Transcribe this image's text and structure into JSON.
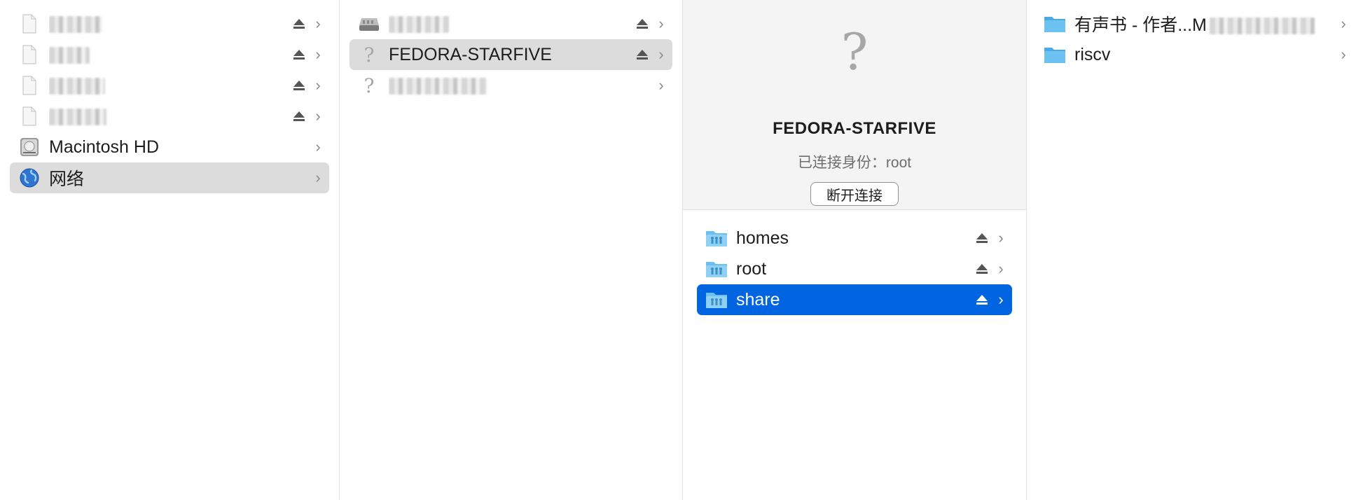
{
  "sidebar": {
    "items": [
      {
        "label": "",
        "redacted": true,
        "icon": "document-icon",
        "has_eject": true
      },
      {
        "label": "",
        "redacted": true,
        "icon": "document-icon",
        "has_eject": true
      },
      {
        "label": "",
        "redacted": true,
        "icon": "document-icon",
        "has_eject": true
      },
      {
        "label": "",
        "redacted": true,
        "icon": "document-icon",
        "has_eject": true
      },
      {
        "label": "Macintosh HD",
        "icon": "hard-drive-icon",
        "has_eject": false
      },
      {
        "label": "网络",
        "icon": "globe-icon",
        "has_eject": false,
        "selected": true
      }
    ]
  },
  "network": {
    "items": [
      {
        "label": "",
        "redacted": true,
        "icon": "server-icon",
        "has_eject": true
      },
      {
        "label": "FEDORA-STARFIVE",
        "icon": "question-icon",
        "has_eject": true,
        "selected": true
      },
      {
        "label": "",
        "redacted": true,
        "icon": "question-icon",
        "has_eject": false
      }
    ]
  },
  "server_preview": {
    "icon": "question-icon",
    "title": "FEDORA-STARFIVE",
    "connected_as": "已连接身份：root",
    "disconnect_label": "断开连接"
  },
  "shares": {
    "items": [
      {
        "label": "homes",
        "icon": "shared-folder-icon",
        "has_eject": true
      },
      {
        "label": "root",
        "icon": "shared-folder-icon",
        "has_eject": true
      },
      {
        "label": "share",
        "icon": "shared-folder-icon",
        "has_eject": true,
        "selected": true
      }
    ]
  },
  "share_contents": {
    "items": [
      {
        "label": "有声书 - 作者...M",
        "icon": "folder-icon",
        "partially_redacted": true
      },
      {
        "label": "riscv",
        "icon": "folder-icon"
      }
    ]
  },
  "colors": {
    "selection_blue": "#0164e1",
    "selection_gray": "#dcdcdc",
    "folder_blue": "#5ab4ec"
  }
}
